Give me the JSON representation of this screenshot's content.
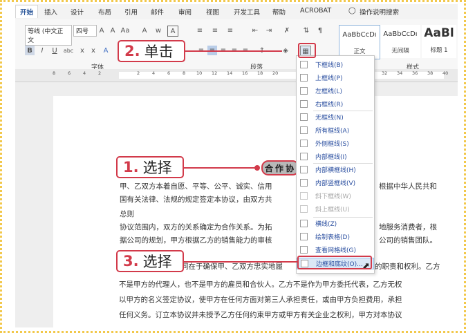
{
  "ribbon": {
    "tabs": [
      "开始",
      "插入",
      "设计",
      "布局",
      "引用",
      "邮件",
      "审阅",
      "视图",
      "开发工具",
      "帮助",
      "ACROBAT"
    ],
    "tell_me": "操作说明搜索",
    "font_name": "等线 (中文正文",
    "font_size": "四号",
    "group_font": "字体",
    "group_paragraph": "段落",
    "group_styles": "样式",
    "style_cards": [
      {
        "sample": "AaBbCcDı",
        "name": "正文"
      },
      {
        "sample": "AaBbCcDı",
        "name": "无间隔"
      },
      {
        "sample": "AaBl",
        "name": "标题 1"
      }
    ]
  },
  "ruler": {
    "ticks": [
      "8",
      "6",
      "4",
      "2",
      "2",
      "4",
      "6",
      "8",
      "10",
      "12",
      "14",
      "16",
      "18",
      "20",
      "32",
      "34",
      "36",
      "38",
      "40"
    ]
  },
  "menu": {
    "items": [
      {
        "label": "下框线(B)",
        "disabled": false
      },
      {
        "label": "上框线(P)",
        "disabled": false
      },
      {
        "label": "左框线(L)",
        "disabled": false
      },
      {
        "label": "右框线(R)",
        "disabled": false
      },
      {
        "label": "无框线(N)",
        "disabled": false
      },
      {
        "label": "所有框线(A)",
        "disabled": false
      },
      {
        "label": "外侧框线(S)",
        "disabled": false
      },
      {
        "label": "内部框线(I)",
        "disabled": false
      },
      {
        "label": "内部横框线(H)",
        "disabled": false
      },
      {
        "label": "内部竖框线(V)",
        "disabled": false
      },
      {
        "label": "斜下框线(W)",
        "disabled": true
      },
      {
        "label": "斜上框线(U)",
        "disabled": true
      },
      {
        "label": "横线(Z)",
        "disabled": false
      },
      {
        "label": "绘制表格(D)",
        "disabled": false
      },
      {
        "label": "查看网格线(G)",
        "disabled": false
      },
      {
        "label": "边框和底纹(O)...",
        "disabled": false,
        "highlighted": true
      }
    ]
  },
  "document": {
    "heading": "合作协",
    "lines": [
      "甲、乙双方本着自愿、平等、公平、诚实、信用",
      "国有关法律、法规的规定签定本协议，由双方共",
      "总则",
      "协议范围内，双方的关系确定为合作关系。为拓",
      "据公司的规划，甲方根据乙方的销售能力的审核",
      "同在于确保甲、乙双方忠实地履",
      "不是甲方的代理人，也不是甲方的雇员和合伙人。乙方不是作为甲方委托代表，乙方无权",
      "以甲方的名义签定协议，使甲方在任何方面对第三人承担责任，或由甲方负担费用，承担",
      "任何义务。订立本协议并未授予乙方任何约束甲方或甲方有关企业之权利，甲方对本协议"
    ],
    "right_fragments": [
      "根据中华人民共和",
      "地服务消费者，根",
      "公司的销售团队。",
      "的职责和权利。乙方"
    ]
  },
  "callouts": {
    "step2": {
      "num": "2.",
      "text": "单击"
    },
    "step1": {
      "num": "1.",
      "text": "选择"
    },
    "step3": {
      "num": "3.",
      "text": "选择"
    }
  },
  "colors": {
    "accent": "#d23a4a",
    "link": "#2b4fa0",
    "frame": "#f2c84b"
  }
}
